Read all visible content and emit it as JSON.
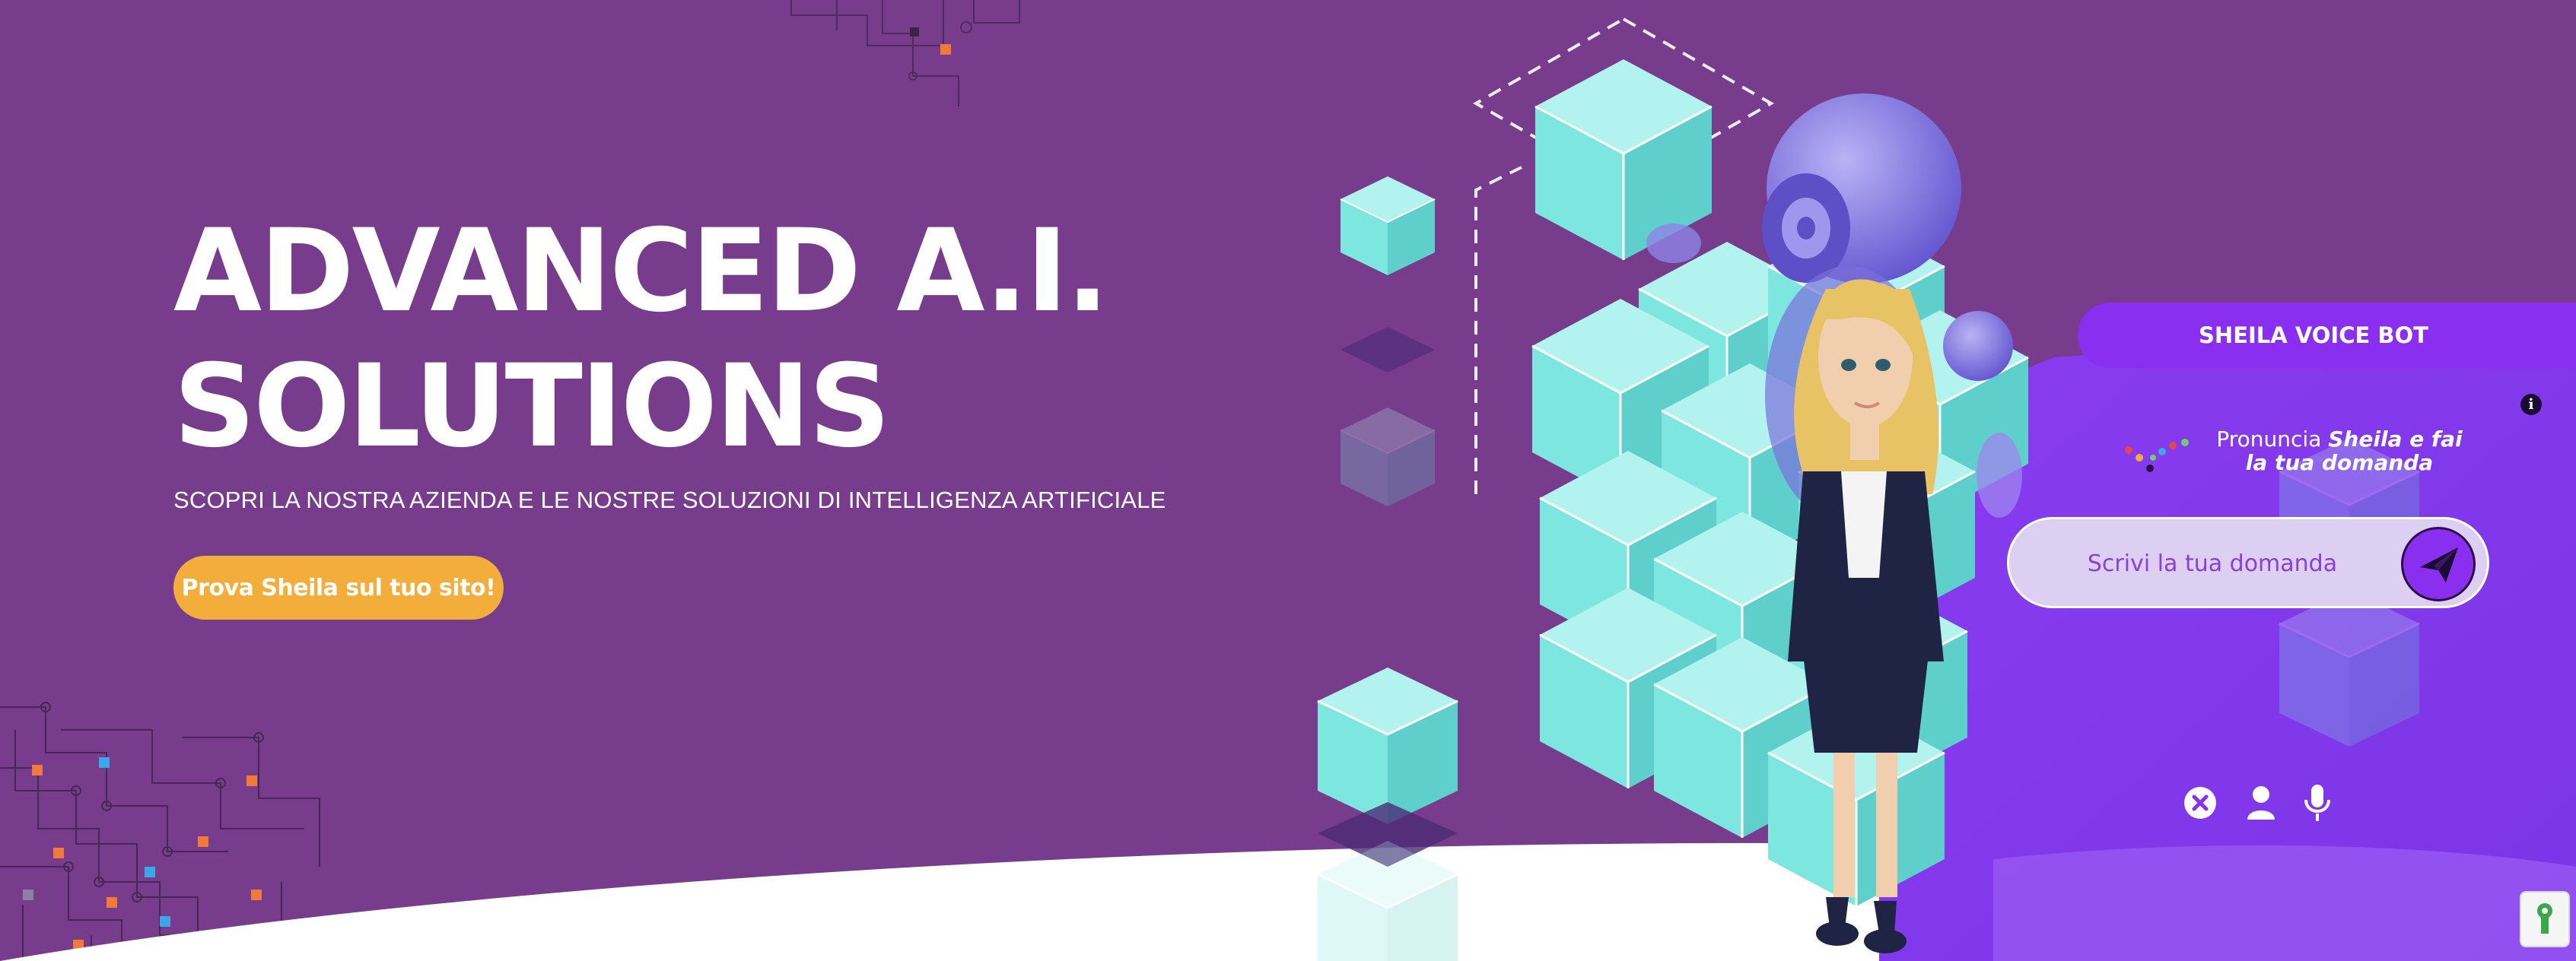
{
  "hero": {
    "title_line1": "ADVANCED A.I.",
    "title_line2": "SOLUTIONS",
    "subtitle": "SCOPRI LA NOSTRA AZIENDA E LE NOSTRE SOLUZIONI DI INTELLIGENZA ARTIFICIALE",
    "cta_label": "Prova Sheila sul tuo sito!"
  },
  "voice_bot": {
    "title": "SHEILA VOICE BOT",
    "info_icon": "info-icon",
    "prompt_prefix": "Pronuncia ",
    "prompt_emphasis": "Sheila e fai la tua domanda",
    "input_placeholder": "Scrivi la tua domanda",
    "send_icon": "paper-plane-icon",
    "controls": [
      "close-icon",
      "user-icon",
      "microphone-icon"
    ]
  },
  "widgets": {
    "password_manager_icon": "keyhole-icon"
  },
  "colors": {
    "background": "#773d8c",
    "cta": "#f2ad3a",
    "bot_accent": "#8a2ef0",
    "cube": "#7de6df"
  }
}
